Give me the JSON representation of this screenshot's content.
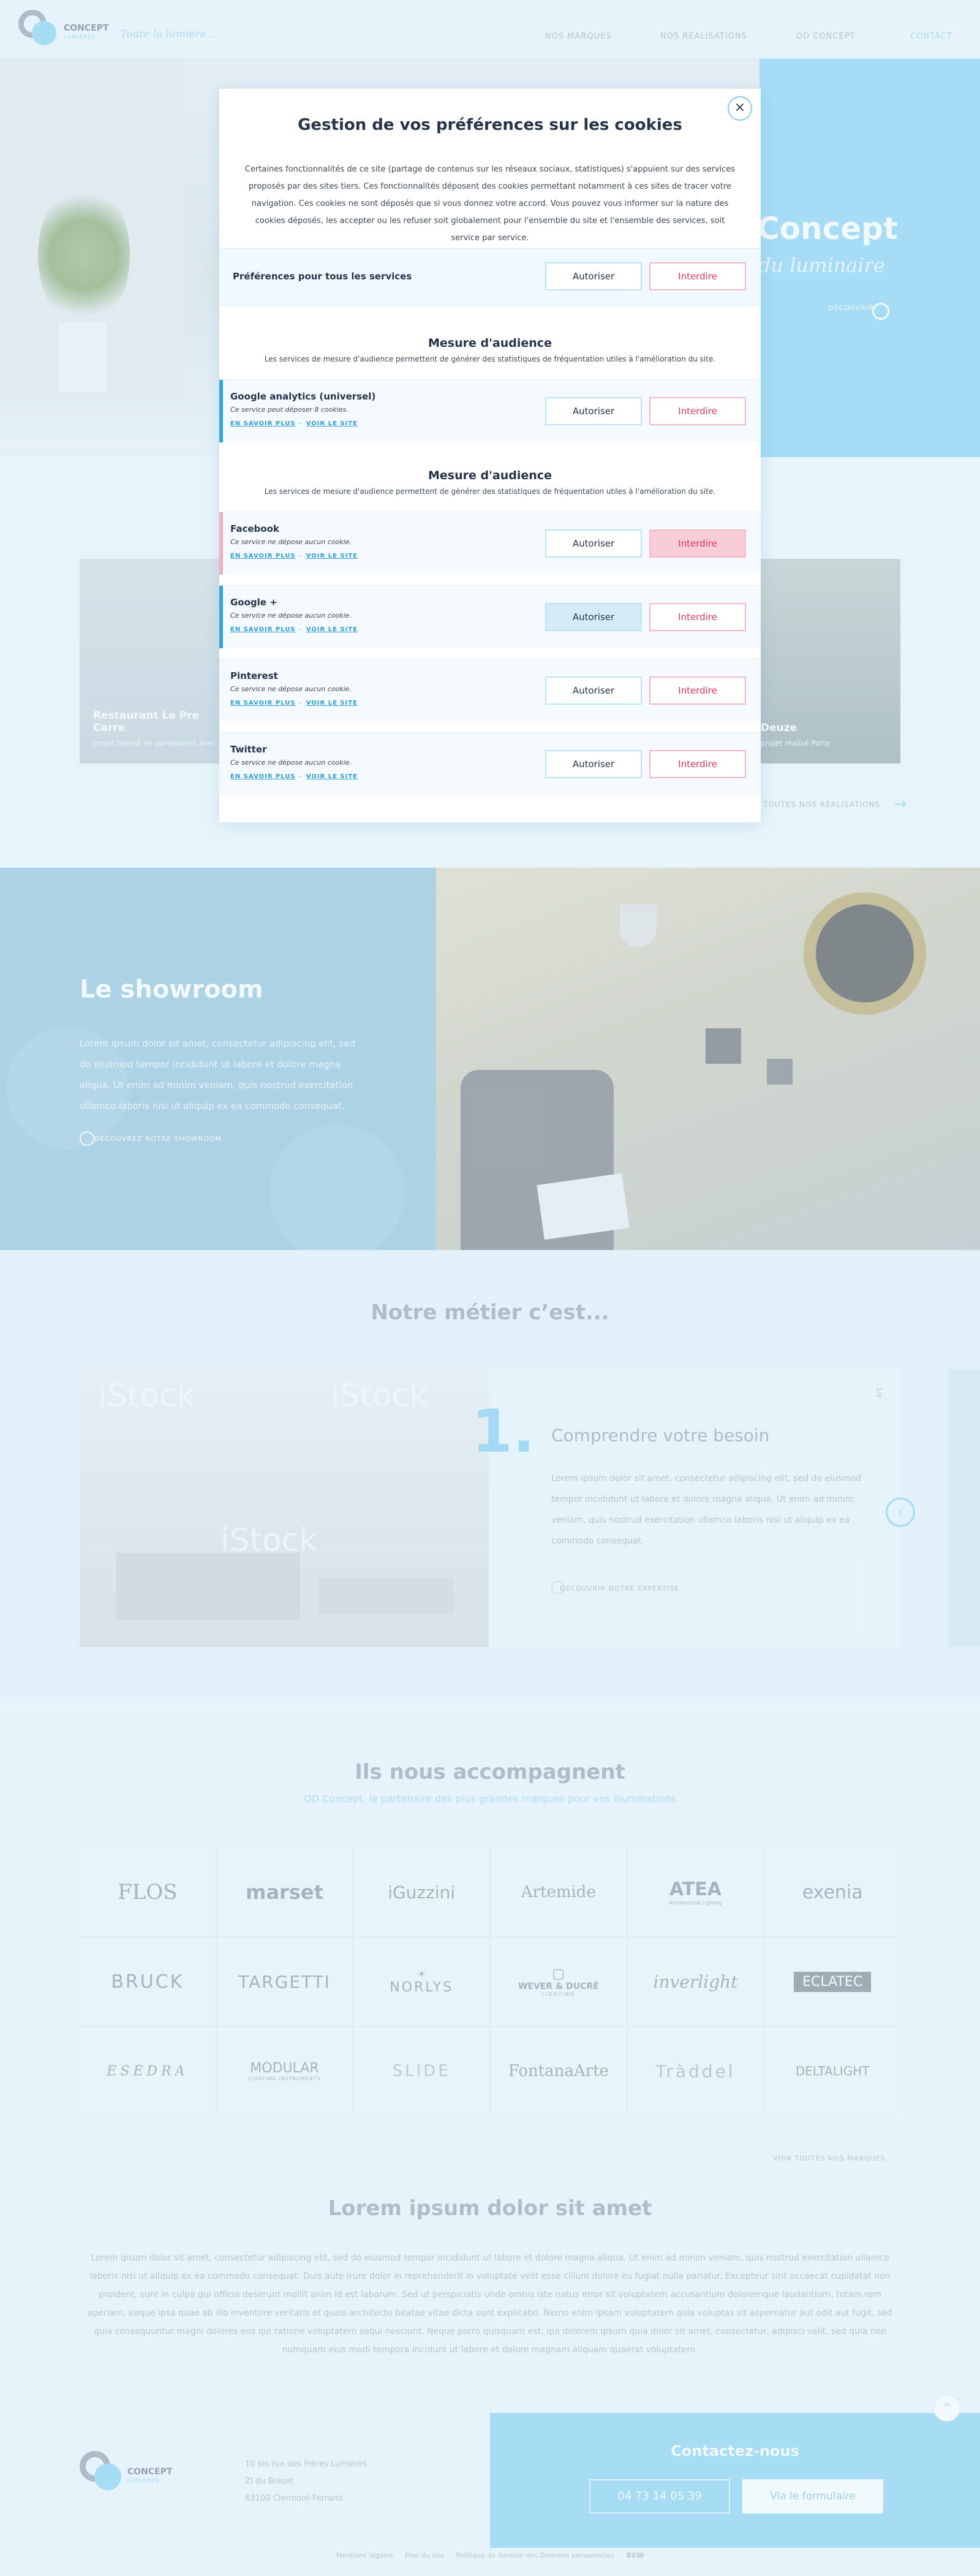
{
  "header": {
    "logo": {
      "word": "CONCEPT",
      "sub": "LUMIERES"
    },
    "slogan": "Toute la lumière...",
    "nav": [
      "NOS MARQUES",
      "NOS RÉALISATIONS",
      "OD CONCEPT",
      "CONTACT"
    ]
  },
  "hero": {
    "title": "Concept",
    "subtitle": "du luminaire",
    "more": "DÉCOUVRIR"
  },
  "realisations": {
    "cards": [
      {
        "title": "Restaurant Le Pre Carre",
        "subtitle": "projet réalisé en partenariat avec le"
      },
      {
        "title": "Deuze",
        "subtitle": "projet réalisé Porte"
      }
    ],
    "all_link": "TOUTES NOS RÉALISATIONS"
  },
  "showroom": {
    "title": "Le showroom",
    "text": "Lorem ipsum dolor sit amet, consectetur adipiscing elit, sed do eiusmod tempor incididunt ut labore et dolore magna aliqua. Ut enim ad minim veniam, quis nostrud exercitation ullamco laboris nisi ut aliquip ex ea commodo consequat.",
    "cta": "DÉCOUVREZ NOTRE SHOWROOM"
  },
  "metier": {
    "title": "Notre métier c’est...",
    "watermark": "iStock",
    "slide": {
      "number": "1.",
      "heading": "Comprendre votre besoin",
      "text": "Lorem ipsum dolor sit amet, consectetur adipiscing elit, sed do eiusmod tempor incididunt ut labore et dolore magna aliqua. Ut enim ad minim veniam, quis nostrud exercitation ullamco laboris nisi ut aliquip ex ea commodo consequat.",
      "cta": "DÉCOUVRIR NOTRE EXPERTISE",
      "counter": "1/4"
    }
  },
  "brands": {
    "title": "Ils nous accompagnent",
    "subtitle": "OD Concept, le partenaire des plus grandes marques pour vos illuminations",
    "logos": [
      "FLOS",
      "marset",
      "iGuzzini",
      "Artemide",
      "ATEA",
      "exenia",
      "BRUCK",
      "TARGETTI",
      "NORLYS",
      "WEVER & DUCRÉ",
      "inverlight",
      "ECLATEC",
      "ESEDRA",
      "MODULAR",
      "SLIDE",
      "FontanaArte",
      "Tràddel",
      "DELTALIGHT"
    ],
    "logo_subs": {
      "atea": "Architectural Lighting",
      "wever": "LIGHTING",
      "modular": "LIGHTING INSTRUMENTS"
    },
    "all_link": "VOIR TOUTES NOS MARQUES"
  },
  "lorem": {
    "title": "Lorem ipsum dolor sit amet",
    "text": "Lorem ipsum dolor sit amet, consectetur adipiscing elit, sed do eiusmod tempor incididunt ut labore et dolore magna aliqua. Ut enim ad minim veniam, quis nostrud exercitation ullamco laboris nisi ut aliquip ex ea commodo consequat. Duis aute irure dolor in reprehenderit in voluptate velit esse cillum dolore eu fugiat nulla pariatur. Excepteur sint occaecat cupidatat non proident, sunt in culpa qui officia deserunt mollit anim id est laborum. Sed ut perspiciatis unde omnis iste natus error sit voluptatem accusantium doloremque laudantium, totam rem aperiam, eaque ipsa quae ab illo inventore veritatis et quasi architecto beatae vitae dicta sunt explicabo. Nemo enim ipsam voluptatem quia voluptas sit aspernatur aut odit aut fugit, sed quia consequuntur magni dolores eos qui ratione voluptatem sequi nesciunt. Neque porro quisquam est, qui dolorem ipsum quia dolor sit amet, consectetur, adipisci velit, sed quia non numquam eius modi tempora incidunt ut labore et dolore magnam aliquam quaerat voluptatem."
  },
  "footer": {
    "address": [
      "10 bis rue des Frères Lumières",
      "ZI du Brézet",
      "63100 Clermont-Ferrand"
    ],
    "contact_title": "Contactez-nous",
    "phone": "04 73 14 05 39",
    "form_button": "Via le formulaire",
    "links": [
      "Mentions légales",
      "Plan du site",
      "Politique de Gestion des Données personnelles",
      "BSW"
    ],
    "scroll_top": "^"
  },
  "modal": {
    "title": "Gestion de vos préférences sur les cookies",
    "close": "×",
    "description": "Certaines fonctionnalités de ce site (partage de contenus sur les réseaux sociaux, statistiques) s'appuient sur des services proposés par des sites tiers. Ces fonctionnalités déposent des cookies permettant notamment à ces sites de tracer votre navigation. Ces cookies ne sont déposés que si vous donnez votre accord. Vous pouvez vous informer sur la nature des cookies déposés, les accepter ou les refuser soit globalement pour l'ensemble du site et l'ensemble des services, soit service par service.",
    "global_label": "Préférences pour tous les services",
    "allow": "Autoriser",
    "deny": "Interdire",
    "learn_more": "EN SAVOIR PLUS",
    "see_site": "VOIR LE SITE",
    "link_sep": "-",
    "section1": {
      "title": "Mesure d'audience",
      "desc": "Les services de mesure d'audience permettent de générer des statistiques de fréquentation utiles à l'amélioration du site."
    },
    "section2": {
      "title": "Mesure d'audience",
      "desc": "Les services de mesure d'audience permettent de générer des statistiques de fréquentation utiles à l'amélioration du site."
    },
    "services": [
      {
        "name": "Google analytics (universel)",
        "note": "Ce service peut déposer 8 cookies."
      },
      {
        "name": "Facebook",
        "note": "Ce service ne dépose aucun cookie."
      },
      {
        "name": "Google +",
        "note": "Ce service ne dépose aucun cookie."
      },
      {
        "name": "Pinterest",
        "note": "Ce service ne dépose aucun cookie."
      },
      {
        "name": "Twitter",
        "note": "Ce service ne dépose aucun cookie."
      }
    ]
  },
  "colors": {
    "accent": "#7fcef2",
    "deny": "#e5385d",
    "navy": "#25344a"
  }
}
